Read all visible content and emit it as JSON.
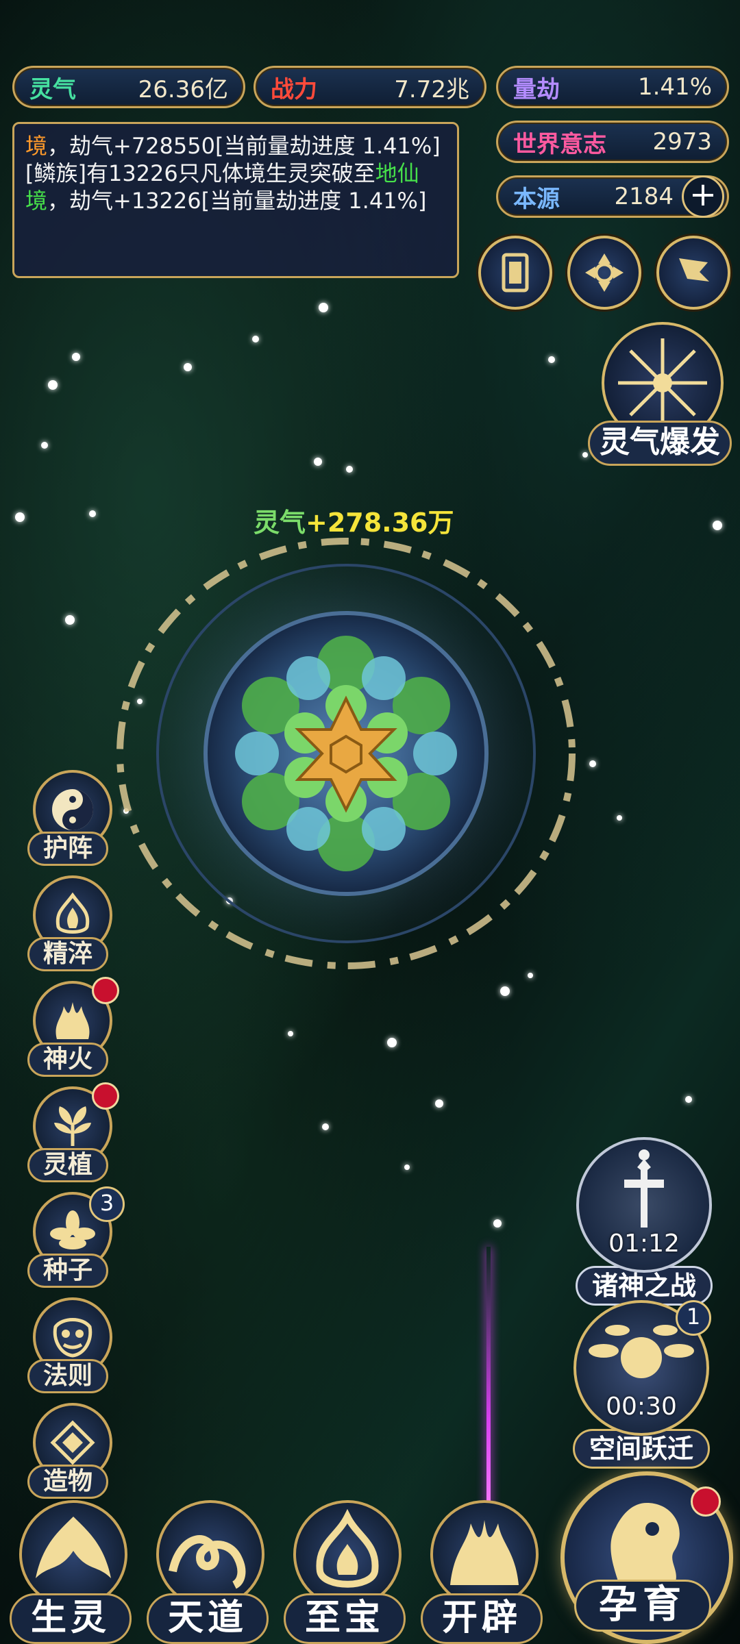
{
  "stats": {
    "lingqi": {
      "label": "灵气",
      "value": "26.36亿",
      "color": "#46e0a0"
    },
    "zhanli": {
      "label": "战力",
      "value": "7.72兆",
      "color": "#ff4a3a"
    },
    "liangjie": {
      "label": "量劫",
      "value": "1.41%",
      "color": "#b48cff"
    },
    "shijie": {
      "label": "世界意志",
      "value": "2973",
      "color": "#ff5aa0"
    },
    "benyuan": {
      "label": "本源",
      "value": "2184",
      "color": "#7ab8ff"
    }
  },
  "log": {
    "line1_prefix": "境",
    "line1_rest": "，劫气+728550[当前量劫进度 1.41%]",
    "line2_part1": "[鳞族]有13226只凡体境生灵突破至",
    "line2_highlight": "地仙境",
    "line2_rest": "，劫气+13226[当前量劫进度 1.41%]"
  },
  "burst": {
    "label": "灵气爆发"
  },
  "planet": {
    "gain_label": "灵气",
    "gain_value": "+278.36万"
  },
  "side_menu": [
    {
      "label": "护阵",
      "dot": false,
      "badge": ""
    },
    {
      "label": "精淬",
      "dot": false,
      "badge": ""
    },
    {
      "label": "神火",
      "dot": true,
      "badge": ""
    },
    {
      "label": "灵植",
      "dot": true,
      "badge": ""
    },
    {
      "label": "种子",
      "dot": false,
      "badge": "3"
    },
    {
      "label": "法则",
      "dot": false,
      "badge": ""
    },
    {
      "label": "造物",
      "dot": false,
      "badge": ""
    }
  ],
  "events": {
    "war": {
      "label": "诸神之战",
      "timer": "01:12"
    },
    "jump": {
      "label": "空间跃迁",
      "timer": "00:30",
      "badge": "1"
    }
  },
  "bottom_nav": [
    {
      "label": "生灵"
    },
    {
      "label": "天道"
    },
    {
      "label": "至宝"
    },
    {
      "label": "开辟"
    }
  ],
  "main_action": {
    "label": "孕育"
  }
}
